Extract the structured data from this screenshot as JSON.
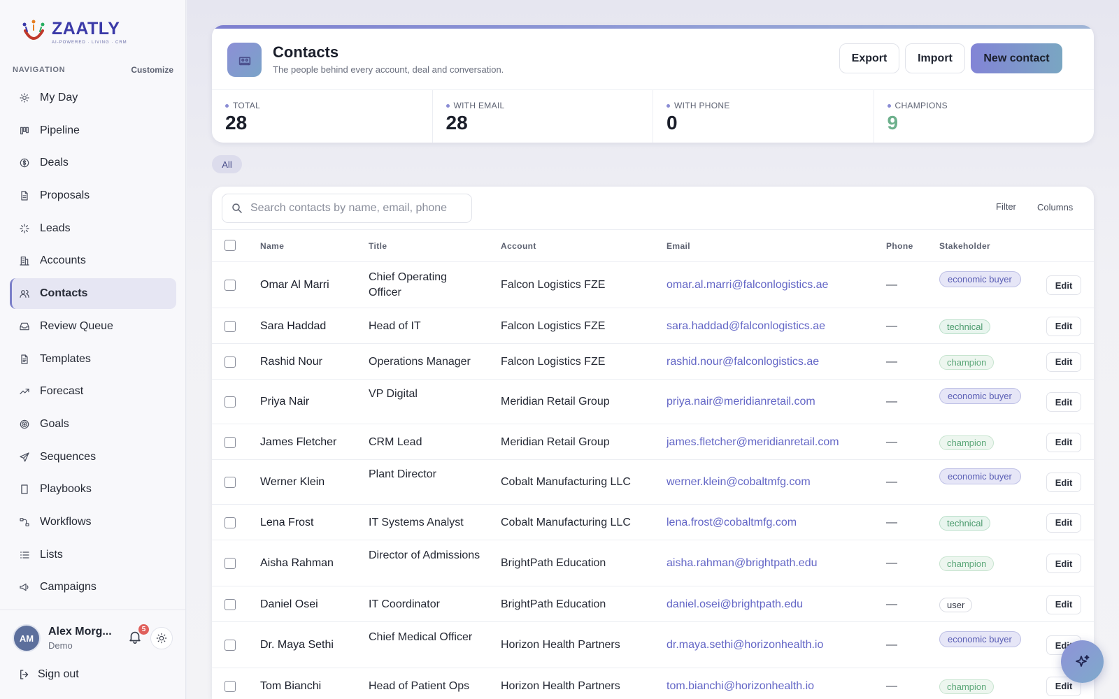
{
  "brand": {
    "name": "ZAATLY",
    "tagline": "AI-POWERED · LIVING · CRM"
  },
  "nav": {
    "heading": "NAVIGATION",
    "customize": "Customize",
    "items": [
      {
        "label": "My Day",
        "icon": "sun-icon"
      },
      {
        "label": "Pipeline",
        "icon": "kanban-icon"
      },
      {
        "label": "Deals",
        "icon": "dollar-circle-icon"
      },
      {
        "label": "Proposals",
        "icon": "document-icon"
      },
      {
        "label": "Leads",
        "icon": "sparkle-icon"
      },
      {
        "label": "Accounts",
        "icon": "building-icon"
      },
      {
        "label": "Contacts",
        "icon": "users-icon",
        "active": true
      },
      {
        "label": "Review Queue",
        "icon": "inbox-icon"
      },
      {
        "label": "Templates",
        "icon": "file-text-icon"
      },
      {
        "label": "Forecast",
        "icon": "trend-up-icon"
      },
      {
        "label": "Goals",
        "icon": "target-icon"
      },
      {
        "label": "Sequences",
        "icon": "send-icon"
      },
      {
        "label": "Playbooks",
        "icon": "book-icon"
      },
      {
        "label": "Workflows",
        "icon": "workflow-icon"
      },
      {
        "label": "Lists",
        "icon": "list-icon"
      },
      {
        "label": "Campaigns",
        "icon": "megaphone-icon"
      }
    ]
  },
  "user": {
    "initials": "AM",
    "name": "Alex Morg...",
    "role": "Demo",
    "notifications": "5",
    "signout": "Sign out"
  },
  "header": {
    "title": "Contacts",
    "subtitle": "The people behind every account, deal and conversation.",
    "export": "Export",
    "import": "Import",
    "new_contact": "New contact"
  },
  "stats": [
    {
      "label": "TOTAL",
      "value": "28"
    },
    {
      "label": "WITH EMAIL",
      "value": "28"
    },
    {
      "label": "WITH PHONE",
      "value": "0"
    },
    {
      "label": "CHAMPIONS",
      "value": "9",
      "accent": "#6db08c"
    }
  ],
  "filter_chip": "All",
  "toolbar": {
    "search_placeholder": "Search contacts by name, email, phone",
    "filter": "Filter",
    "columns": "Columns"
  },
  "table": {
    "headers": {
      "name": "Name",
      "title": "Title",
      "account": "Account",
      "email": "Email",
      "phone": "Phone",
      "stakeholder": "Stakeholder"
    },
    "edit_label": "Edit",
    "rows": [
      {
        "name": "Omar Al Marri",
        "title": "Chief Operating Officer",
        "account": "Falcon Logistics FZE",
        "email": "omar.al.marri@falconlogistics.ae",
        "phone": "—",
        "stakeholder": "economic buyer",
        "kind": "econ"
      },
      {
        "name": "Sara Haddad",
        "title": "Head of IT",
        "account": "Falcon Logistics FZE",
        "email": "sara.haddad@falconlogistics.ae",
        "phone": "—",
        "stakeholder": "technical",
        "kind": "tech"
      },
      {
        "name": "Rashid Nour",
        "title": "Operations Manager",
        "account": "Falcon Logistics FZE",
        "email": "rashid.nour@falconlogistics.ae",
        "phone": "—",
        "stakeholder": "champion",
        "kind": "champ"
      },
      {
        "name": "Priya Nair",
        "title": "VP Digital",
        "account": "Meridian Retail Group",
        "email": "priya.nair@meridianretail.com",
        "phone": "—",
        "stakeholder": "economic buyer",
        "kind": "econ"
      },
      {
        "name": "James Fletcher",
        "title": "CRM Lead",
        "account": "Meridian Retail Group",
        "email": "james.fletcher@meridianretail.com",
        "phone": "—",
        "stakeholder": "champion",
        "kind": "champ"
      },
      {
        "name": "Werner Klein",
        "title": "Plant Director",
        "account": "Cobalt Manufacturing LLC",
        "email": "werner.klein@cobaltmfg.com",
        "phone": "—",
        "stakeholder": "economic buyer",
        "kind": "econ"
      },
      {
        "name": "Lena Frost",
        "title": "IT Systems Analyst",
        "account": "Cobalt Manufacturing LLC",
        "email": "lena.frost@cobaltmfg.com",
        "phone": "—",
        "stakeholder": "technical",
        "kind": "tech"
      },
      {
        "name": "Aisha Rahman",
        "title": "Director of Admissions",
        "account": "BrightPath Education",
        "email": "aisha.rahman@brightpath.edu",
        "phone": "—",
        "stakeholder": "champion",
        "kind": "champ"
      },
      {
        "name": "Daniel Osei",
        "title": "IT Coordinator",
        "account": "BrightPath Education",
        "email": "daniel.osei@brightpath.edu",
        "phone": "—",
        "stakeholder": "user",
        "kind": "user"
      },
      {
        "name": "Dr. Maya Sethi",
        "title": "Chief Medical Officer",
        "account": "Horizon Health Partners",
        "email": "dr.maya.sethi@horizonhealth.io",
        "phone": "—",
        "stakeholder": "economic buyer",
        "kind": "econ"
      },
      {
        "name": "Tom Bianchi",
        "title": "Head of Patient Ops",
        "account": "Horizon Health Partners",
        "email": "tom.bianchi@horizonhealth.io",
        "phone": "—",
        "stakeholder": "champion",
        "kind": "champ"
      }
    ]
  }
}
